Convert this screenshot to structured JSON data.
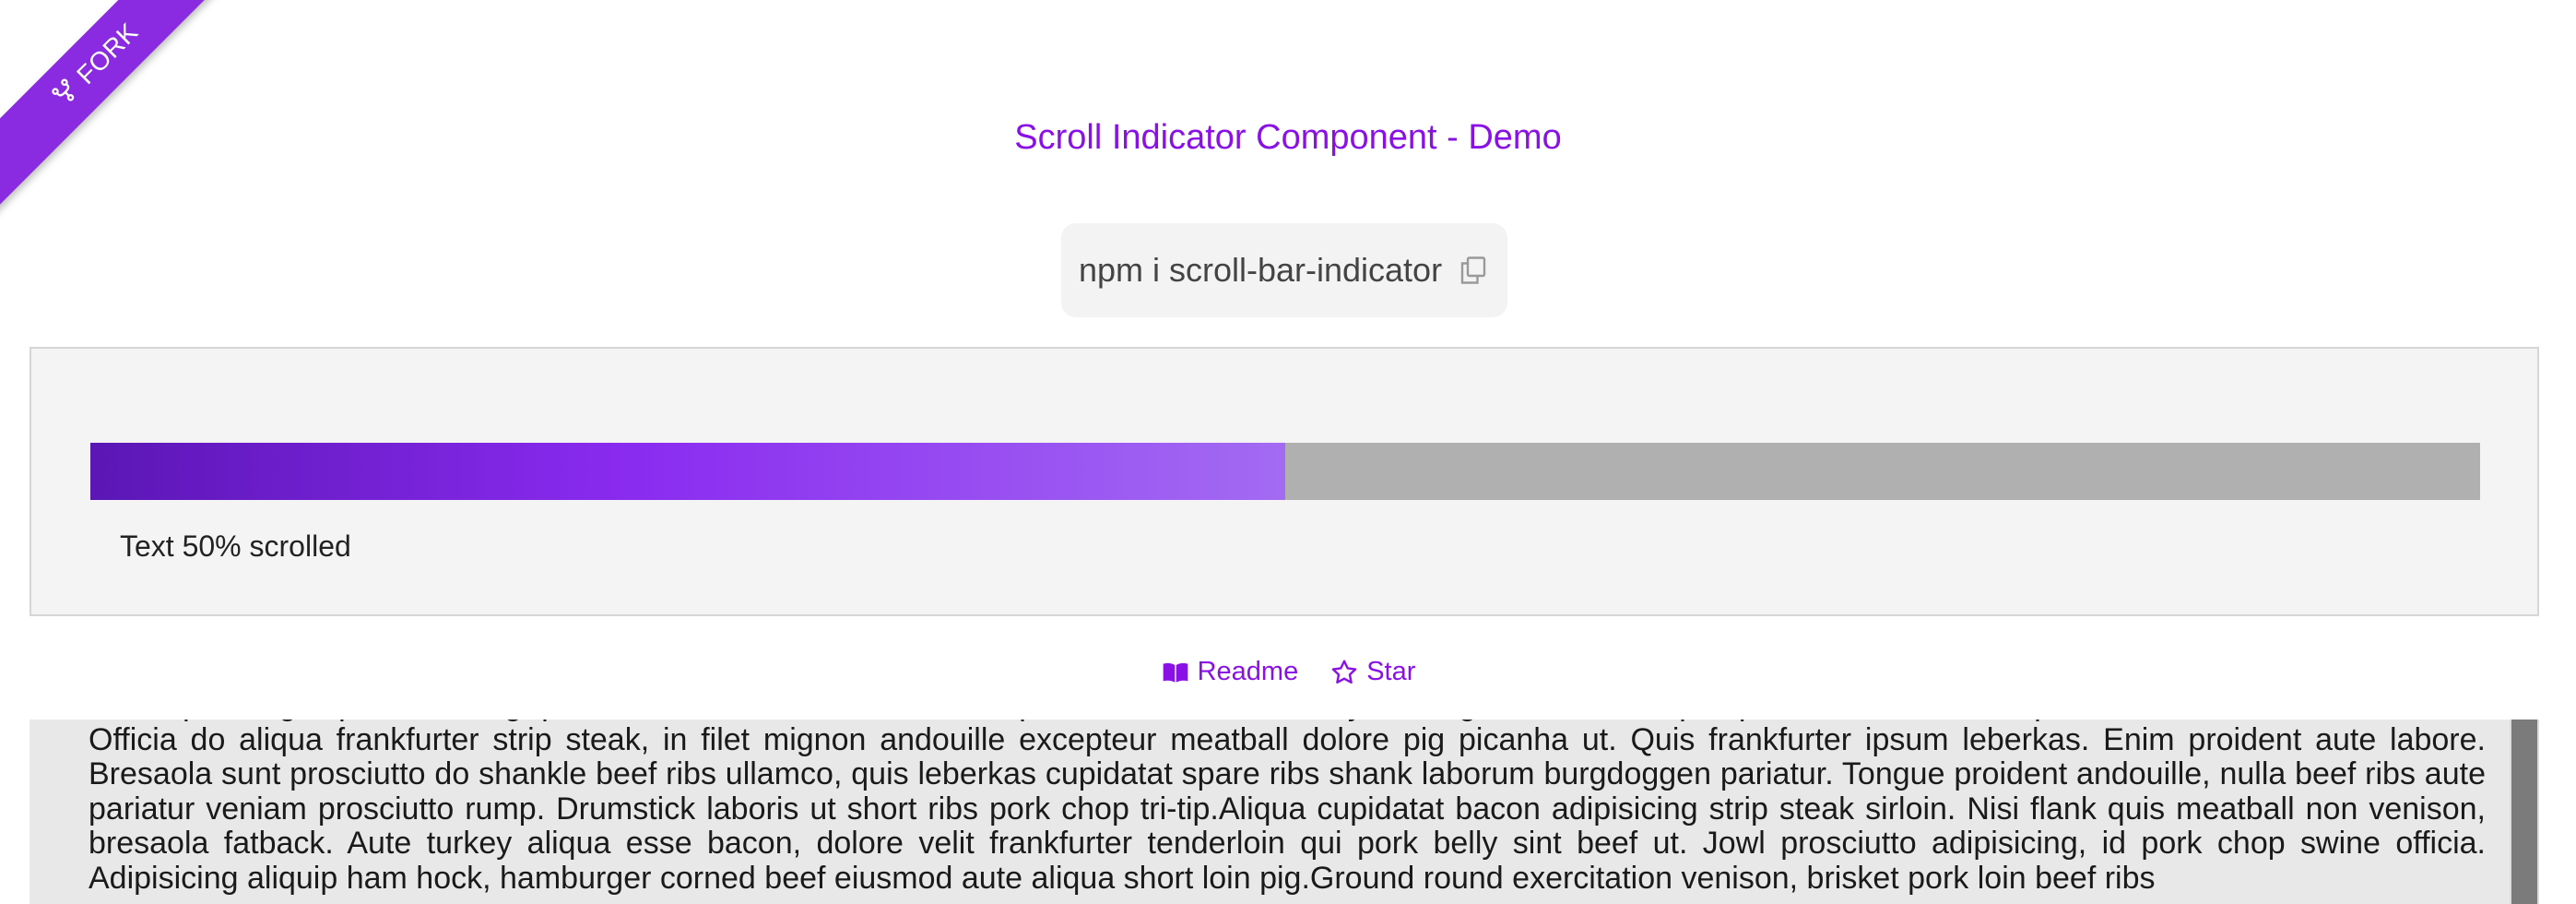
{
  "ribbon": {
    "label": "FORK",
    "icon": "fork-icon"
  },
  "header": {
    "title": "Scroll Indicator Component - Demo"
  },
  "install": {
    "command": "npm i scroll-bar-indicator",
    "icon": "copy-icon"
  },
  "indicator": {
    "progress_percent": 50,
    "status_text": "Text 50% scrolled"
  },
  "links": [
    {
      "label": "Readme",
      "icon": "book-icon"
    },
    {
      "label": "Star",
      "icon": "star-icon"
    }
  ],
  "article": {
    "text": "consequat. Pig capicola biltong quis laboris. Pastrami bresaola in spare ribs leberkas turkey.Sausage occaecat aliqua, pancetta irure consequat. Bacon labore ham hock ea. Officia do aliqua frankfurter strip steak, in filet mignon andouille excepteur meatball dolore pig picanha ut. Quis frankfurter ipsum leberkas. Enim proident aute labore. Bresaola sunt prosciutto do shankle beef ribs ullamco, quis leberkas cupidatat spare ribs shank laborum burgdoggen pariatur. Tongue proident andouille, nulla beef ribs aute pariatur veniam prosciutto rump. Drumstick laboris ut short ribs pork chop tri-tip.Aliqua cupidatat bacon adipisicing strip steak sirloin. Nisi flank quis meatball non venison, bresaola fatback. Aute turkey aliqua esse bacon, dolore velit frankfurter tenderloin qui pork belly sint beef ut. Jowl prosciutto adipisicing, id pork chop swine officia. Adipisicing aliquip ham hock, hamburger corned beef eiusmod aute aliqua short loin pig.Ground round exercitation venison, brisket pork loin beef ribs"
  },
  "colors": {
    "accent": "#8a11e6",
    "ribbon": "#8a2be2",
    "track": "#b0b0b0",
    "panel": "#f4f4f4"
  }
}
